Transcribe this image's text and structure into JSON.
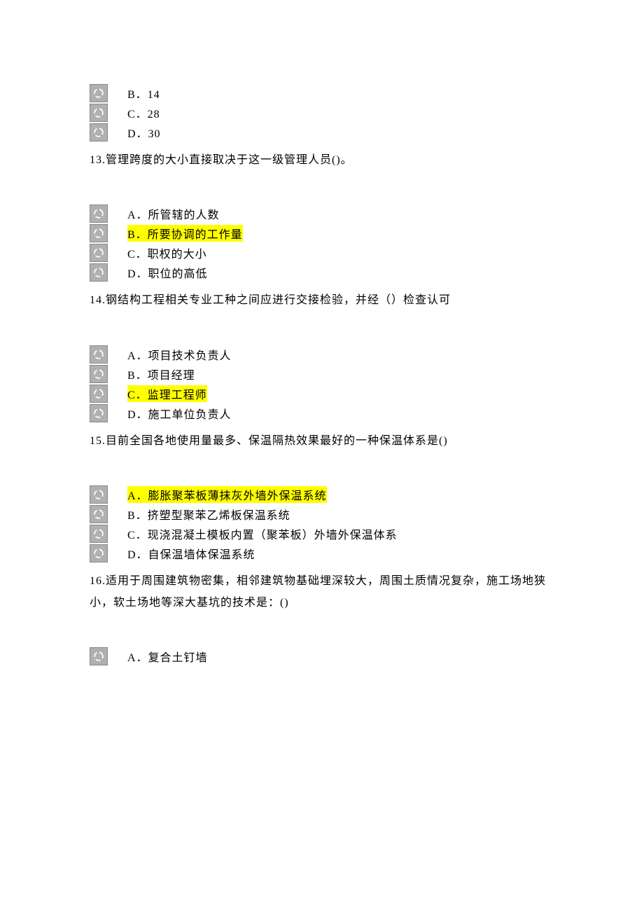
{
  "leading_options": [
    {
      "label": "B．14",
      "highlight": false
    },
    {
      "label": "C．28",
      "highlight": false
    },
    {
      "label": "D．30",
      "highlight": false
    }
  ],
  "questions": [
    {
      "number": "13",
      "text": "13.管理跨度的大小直接取决于这一级管理人员()。",
      "options": [
        {
          "label": "A．所管辖的人数",
          "highlight": false
        },
        {
          "label": "B．所要协调的工作量",
          "highlight": true
        },
        {
          "label": "C．职权的大小",
          "highlight": false
        },
        {
          "label": "D．职位的高低",
          "highlight": false
        }
      ]
    },
    {
      "number": "14",
      "text": "14.钢结构工程相关专业工种之间应进行交接检验，并经（）检查认可",
      "options": [
        {
          "label": "A．项目技术负责人",
          "highlight": false
        },
        {
          "label": "B．项目经理",
          "highlight": false
        },
        {
          "label": "C．监理工程师",
          "highlight": true
        },
        {
          "label": "D．施工单位负责人",
          "highlight": false
        }
      ]
    },
    {
      "number": "15",
      "text": "15.目前全国各地使用量最多、保温隔热效果最好的一种保温体系是()",
      "options": [
        {
          "label": "A．膨胀聚苯板薄抹灰外墙外保温系统",
          "highlight": true
        },
        {
          "label": "B．挤塑型聚苯乙烯板保温系统",
          "highlight": false
        },
        {
          "label": "C．现浇混凝土模板内置（聚苯板）外墙外保温体系",
          "highlight": false
        },
        {
          "label": "D．自保温墙体保温系统",
          "highlight": false
        }
      ]
    },
    {
      "number": "16",
      "text": "16.适用于周围建筑物密集，相邻建筑物基础埋深较大，周围土质情况复杂，施工场地狭小，软土场地等深大基坑的技术是：()",
      "options": [
        {
          "label": "A．复合土钉墙",
          "highlight": false
        }
      ]
    }
  ]
}
